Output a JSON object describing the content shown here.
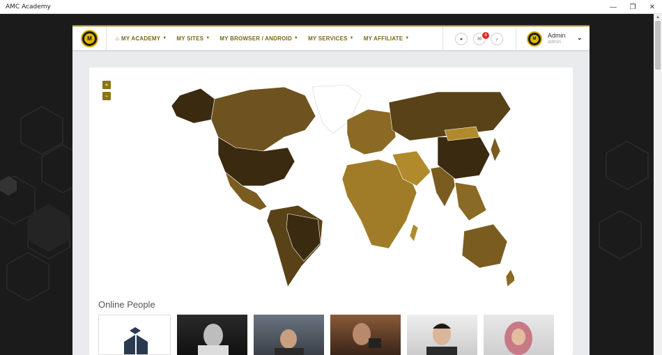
{
  "window": {
    "title": "AMC Academy"
  },
  "nav": {
    "menu": [
      {
        "label": "MY ACADEMY",
        "icon": "home-icon"
      },
      {
        "label": "MY SITES"
      },
      {
        "label": "MY BROWSER / ANDROID"
      },
      {
        "label": "MY SERVICES"
      },
      {
        "label": "MY AFFILIATE"
      }
    ],
    "messages_count": "4",
    "user": {
      "name": "Admin",
      "role": "admin"
    }
  },
  "map": {
    "zoom_in": "+",
    "zoom_out": "−"
  },
  "online": {
    "title": "Online People",
    "people_count": 6
  },
  "colors": {
    "accent": "#8a7412",
    "map_dark": "#3a2a10",
    "map_mid": "#7a5c20",
    "map_light": "#b08a2c"
  }
}
